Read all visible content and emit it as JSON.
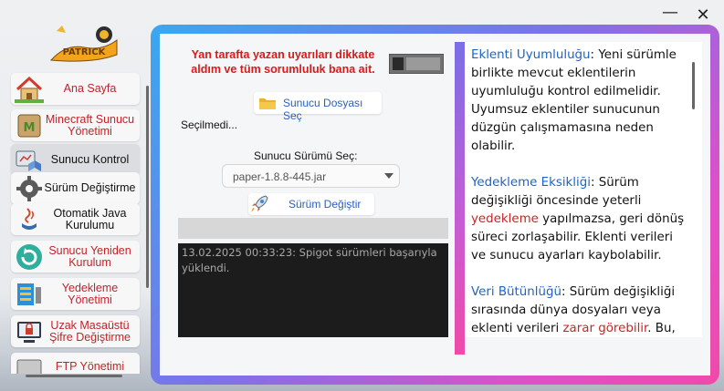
{
  "window": {
    "minimize_symbol": "—",
    "close_symbol": "✕"
  },
  "logo": {
    "text": "PATRICK"
  },
  "sidebar": {
    "items": [
      {
        "label": "Ana Sayfa",
        "icon": "house-icon"
      },
      {
        "label": "Minecraft Sunucu Yönetimi",
        "icon": "minecraft-icon"
      },
      {
        "label": "Sunucu Kontrol",
        "icon": "server-control-icon"
      },
      {
        "label": "Sürüm Değiştirme",
        "icon": "gear-wrench-icon"
      },
      {
        "label": "Otomatik Java Kurulumu",
        "icon": "java-icon"
      },
      {
        "label": "Sunucu Yeniden Kurulum",
        "icon": "refresh-icon"
      },
      {
        "label": "Yedekleme Yönetimi",
        "icon": "backup-icon"
      },
      {
        "label": "Uzak Masaüstü Şifre Değiştirme",
        "icon": "remote-lock-icon"
      },
      {
        "label": "FTP Yönetimi",
        "icon": "ftp-icon"
      }
    ]
  },
  "left_panel": {
    "warning_text": "Yan tarafta yazan uyarıları dikkate aldım ve tüm sorumluluk bana ait.",
    "select_file_button": "Sunucu Dosyası Seç",
    "selected_file_status": "Seçilmedi...",
    "version_label": "Sunucu Sürümü Seç:",
    "version_value": "paper-1.8.8-445.jar",
    "change_version_button": "Sürüm Değiştir",
    "console_text": "13.02.2025 00:33:23: Spigot sürümleri başarıyla yüklendi."
  },
  "info_panel": {
    "p1_key": "Eklenti Uyumluluğu",
    "p1_text": ": Yeni sürümle birlikte mevcut eklentilerin uyumluluğu kontrol edilmelidir. Uyumsuz eklentiler sunucunun düzgün çalışmamasına neden olabilir.",
    "p2_key": "Yedekleme Eksikliği",
    "p2_text_a": ": Sürüm değişikliği öncesinde yeterli ",
    "p2_red": "yedekleme",
    "p2_text_b": " yapılmazsa, geri dönüş süreci zorlaşabilir. Eklenti verileri ve sunucu ayarları kaybolabilir.",
    "p3_key": "Veri Bütünlüğü",
    "p3_text_a": ": Sürüm değişikliği sırasında dünya dosyaları veya eklenti verileri ",
    "p3_red": "zarar görebilir",
    "p3_text_b": ". Bu,"
  },
  "colors": {
    "warning_red": "#d81a1a",
    "link_blue": "#2a5fc1",
    "frame_gradient_start": "#3aa8f0",
    "frame_gradient_end": "#f04aa9",
    "console_bg": "#1c1c1c"
  }
}
